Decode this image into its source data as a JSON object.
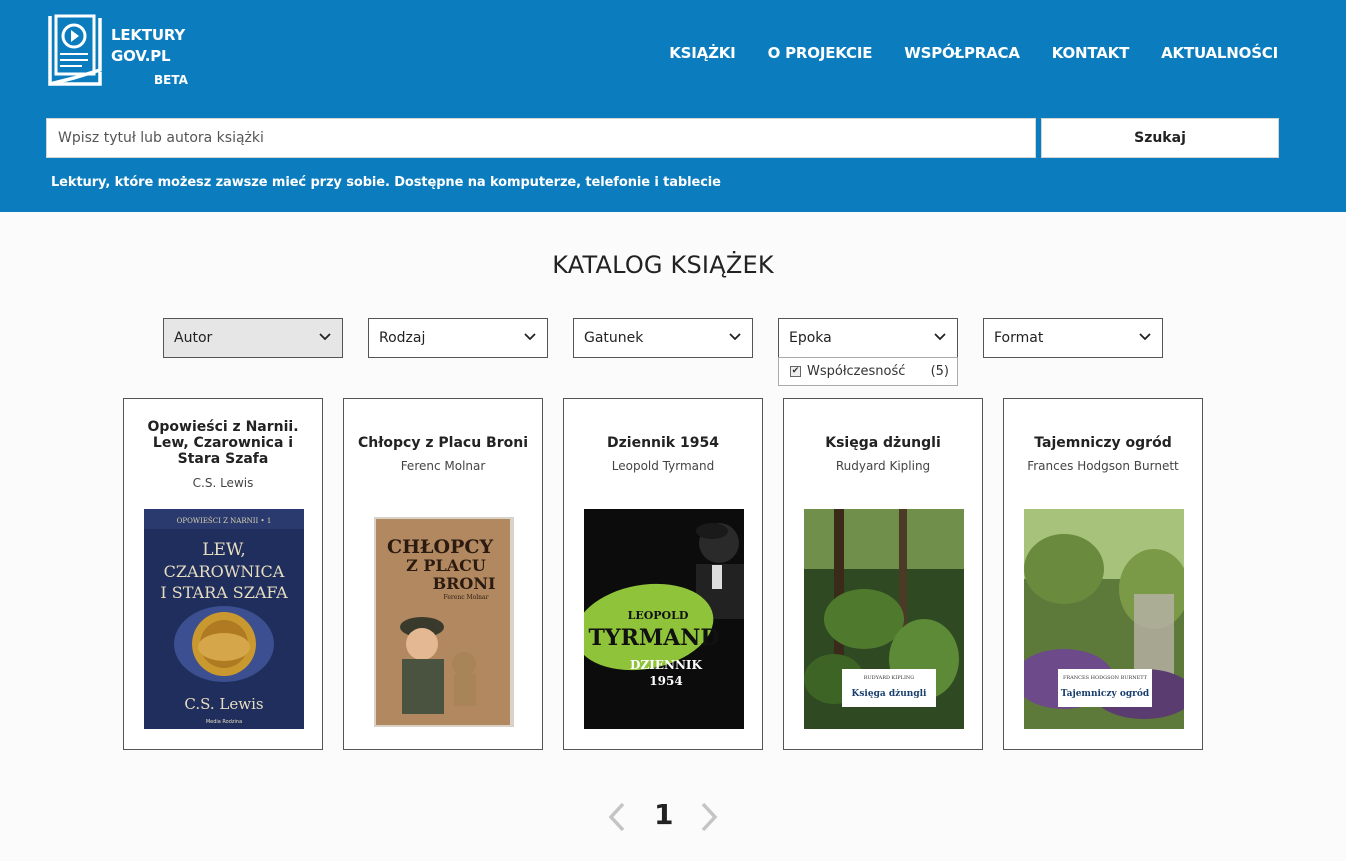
{
  "logo": {
    "line1": "LEKTURY",
    "line2": "GOV.PL",
    "beta": "BETA"
  },
  "nav": [
    "KSIĄŻKI",
    "O PROJEKCIE",
    "WSPÓŁPRACA",
    "KONTAKT",
    "AKTUALNOŚCI"
  ],
  "search": {
    "placeholder": "Wpisz tytuł lub autora książki",
    "button": "Szukaj"
  },
  "tagline": "Lektury, które możesz zawsze mieć przy sobie. Dostępne na komputerze, telefonie i tablecie",
  "catalog_title": "KATALOG KSIĄŻEK",
  "filters": [
    "Autor",
    "Rodzaj",
    "Gatunek",
    "Epoka",
    "Format"
  ],
  "epoka_option": {
    "label": "Współczesność",
    "count": "(5)",
    "checked": true
  },
  "books": [
    {
      "title": "Opowieści z Narnii. Lew, Czarownica i Stara Szafa",
      "author": "C.S. Lewis",
      "cover": {
        "series": "OPOWIEŚCI Z NARNII • 1",
        "line1": "LEW,",
        "line2": "CZAROWNICA",
        "line3": "I STARA SZAFA",
        "author": "C.S. Lewis",
        "publisher": "Media Rodzina"
      }
    },
    {
      "title": "Chłopcy z Placu Broni",
      "author": "Ferenc Molnar",
      "cover": {
        "line1": "CHŁOPCY",
        "line2": "Z PLACU",
        "line3": "BRONI",
        "author": "Ferenc Molnar"
      }
    },
    {
      "title": "Dziennik 1954",
      "author": "Leopold Tyrmand",
      "cover": {
        "line1": "LEOPOLD",
        "line2": "TYRMAND",
        "line3": "DZIENNIK",
        "line4": "1954"
      }
    },
    {
      "title": "Księga dżungli",
      "author": "Rudyard Kipling",
      "cover": {
        "author": "RUDYARD KIPLING",
        "title": "Księga dżungli"
      }
    },
    {
      "title": "Tajemniczy ogród",
      "author": "Frances Hodgson Burnett",
      "cover": {
        "author": "FRANCES HODGSON BURNETT",
        "title": "Tajemniczy ogród"
      }
    }
  ],
  "pagination": {
    "current": "1"
  },
  "colors": {
    "header": "#0b7dbf",
    "text": "#222222"
  },
  "icons": {
    "logo": "book-play-icon",
    "chevron": "chevron-down-icon",
    "prev": "chevron-left-icon",
    "next": "chevron-right-icon"
  }
}
